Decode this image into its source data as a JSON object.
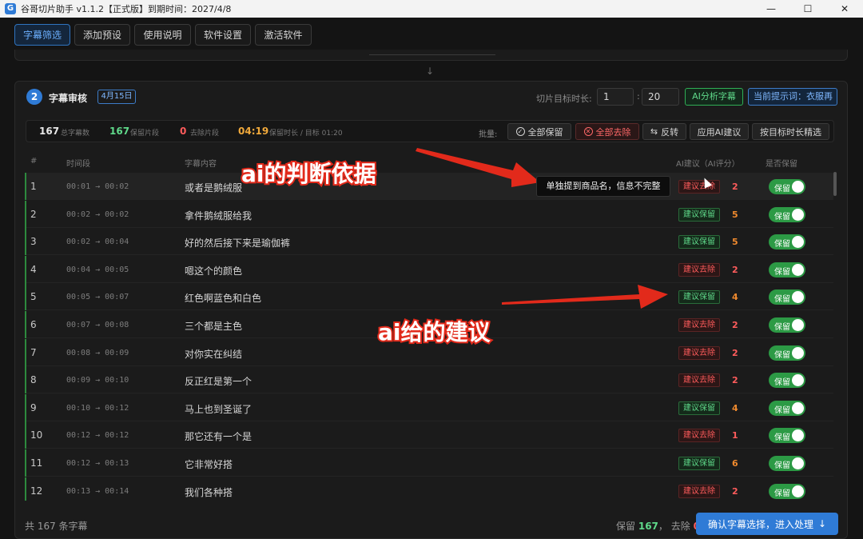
{
  "window": {
    "title": "谷哥切片助手 v1.1.2【正式版】到期时间：2027/4/8",
    "logo": "G"
  },
  "tabs": [
    {
      "label": "字幕筛选",
      "active": true
    },
    {
      "label": "添加预设",
      "active": false
    },
    {
      "label": "使用说明",
      "active": false
    },
    {
      "label": "软件设置",
      "active": false
    },
    {
      "label": "激活软件",
      "active": false
    }
  ],
  "panel": {
    "step": "2",
    "title": "字幕审核",
    "date": "4月15日",
    "target_label": "切片目标时长:",
    "target_min": "1",
    "colon": ":",
    "target_sec": "20",
    "ai_analyze": "AI分析字幕",
    "hint": "当前提示词：衣服再"
  },
  "stats": {
    "total": "167",
    "total_label": "总字幕数",
    "keep": "167",
    "keep_label": "保留片段",
    "remove": "0",
    "remove_label": "去除片段",
    "duration": "04:19",
    "duration_label": "保留时长 / 目标 01:20",
    "batch_label": "批量:",
    "btn_keep_all": "全部保留",
    "btn_remove_all": "全部去除",
    "btn_invert": "反转",
    "btn_apply_ai": "应用AI建议",
    "btn_target_select": "按目标时长精选"
  },
  "columns": {
    "idx": "#",
    "time": "时间段",
    "text": "字幕内容",
    "ai": "AI建议（AI评分）",
    "keep": "是否保留"
  },
  "rows": [
    {
      "idx": "1",
      "time": "00:01 → 00:02",
      "text": "或者是鹅绒服",
      "suggest": "建议去除",
      "kind": "remove",
      "score": "2",
      "toggle": "保留"
    },
    {
      "idx": "2",
      "time": "00:02 → 00:02",
      "text": "拿件鹅绒服给我",
      "suggest": "建议保留",
      "kind": "keep",
      "score": "5",
      "toggle": "保留"
    },
    {
      "idx": "3",
      "time": "00:02 → 00:04",
      "text": "好的然后接下来是瑜伽裤",
      "suggest": "建议保留",
      "kind": "keep",
      "score": "5",
      "toggle": "保留"
    },
    {
      "idx": "4",
      "time": "00:04 → 00:05",
      "text": "嗯这个的颜色",
      "suggest": "建议去除",
      "kind": "remove",
      "score": "2",
      "toggle": "保留"
    },
    {
      "idx": "5",
      "time": "00:05 → 00:07",
      "text": "红色啊蓝色和白色",
      "suggest": "建议保留",
      "kind": "keep",
      "score": "4",
      "toggle": "保留"
    },
    {
      "idx": "6",
      "time": "00:07 → 00:08",
      "text": "三个都是主色",
      "suggest": "建议去除",
      "kind": "remove",
      "score": "2",
      "toggle": "保留"
    },
    {
      "idx": "7",
      "time": "00:08 → 00:09",
      "text": "对你实在纠结",
      "suggest": "建议去除",
      "kind": "remove",
      "score": "2",
      "toggle": "保留"
    },
    {
      "idx": "8",
      "time": "00:09 → 00:10",
      "text": "反正红是第一个",
      "suggest": "建议去除",
      "kind": "remove",
      "score": "2",
      "toggle": "保留"
    },
    {
      "idx": "9",
      "time": "00:10 → 00:12",
      "text": "马上也到圣诞了",
      "suggest": "建议保留",
      "kind": "keep",
      "score": "4",
      "toggle": "保留"
    },
    {
      "idx": "10",
      "time": "00:12 → 00:12",
      "text": "那它还有一个是",
      "suggest": "建议去除",
      "kind": "remove",
      "score": "1",
      "toggle": "保留"
    },
    {
      "idx": "11",
      "time": "00:12 → 00:13",
      "text": "它非常好搭",
      "suggest": "建议保留",
      "kind": "keep",
      "score": "6",
      "toggle": "保留"
    },
    {
      "idx": "12",
      "time": "00:13 → 00:14",
      "text": "我们各种搭",
      "suggest": "建议去除",
      "kind": "remove",
      "score": "2",
      "toggle": "保留"
    }
  ],
  "footer": {
    "total": "共 167 条字幕",
    "keep_label": "保留",
    "keep_value": "167",
    "sep": "，",
    "remove_label": "去除",
    "remove_value": "0",
    "confirm": "确认字幕选择，进入处理"
  },
  "tooltip": "单独提到商品名，信息不完整",
  "annotations": {
    "basis": "ai的判断依据",
    "suggestion": "ai给的建议"
  },
  "colors": {
    "accent": "#2f7bd6",
    "keep": "#5fd98a",
    "remove": "#ff5c5c",
    "duration": "#f0a93b",
    "score": "#f08a2e",
    "annotation": "#e22a1b"
  }
}
